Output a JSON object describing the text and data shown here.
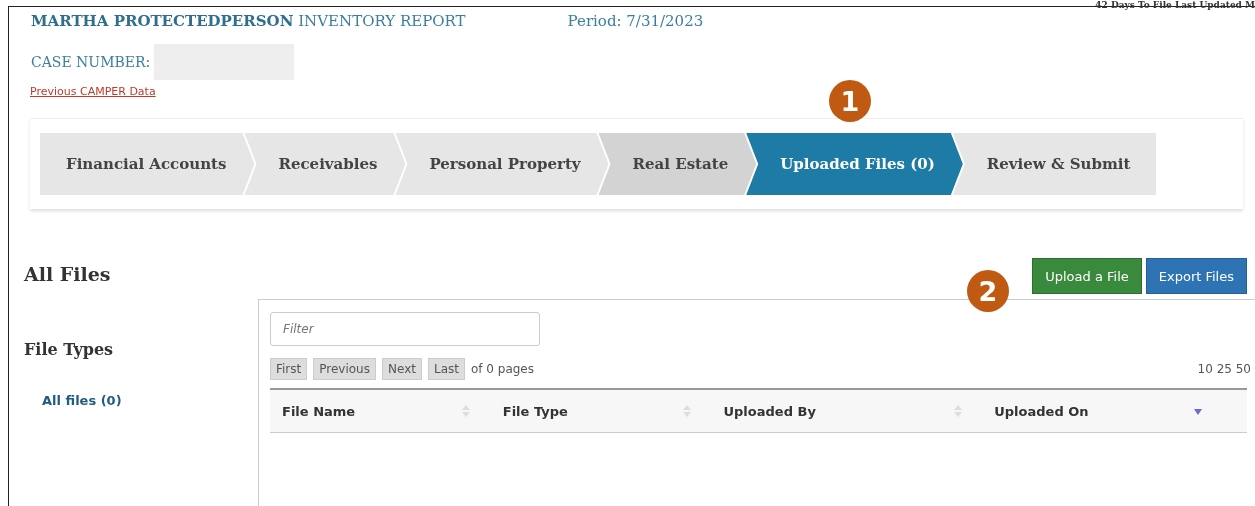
{
  "header": {
    "name": "MARTHA PROTECTEDPERSON",
    "report": "INVENTORY REPORT",
    "period": "Period: 7/31/2023",
    "corner_text": "42 Days To File Last Updated M",
    "case_label": "CASE NUMBER:",
    "previous_link": "Previous CAMPER Data"
  },
  "steps": [
    {
      "label": "Financial Accounts",
      "selected": false,
      "shaded": false
    },
    {
      "label": "Receivables",
      "selected": false,
      "shaded": false
    },
    {
      "label": "Personal Property",
      "selected": false,
      "shaded": false
    },
    {
      "label": "Real Estate",
      "selected": false,
      "shaded": true
    },
    {
      "label": "Uploaded Files (0)",
      "selected": true,
      "shaded": false
    },
    {
      "label": "Review & Submit",
      "selected": false,
      "shaded": false
    }
  ],
  "callouts": [
    "1",
    "2"
  ],
  "section_title": "All Files",
  "buttons": [
    {
      "label": "Upload a File",
      "kind": "primary"
    },
    {
      "label": "Export Files",
      "kind": "secondary"
    }
  ],
  "sidebar": {
    "title": "File Types",
    "items": [
      {
        "label": "All files (0)"
      }
    ]
  },
  "table": {
    "filter_placeholder": "Filter",
    "pager": [
      "First",
      "Previous",
      "Next",
      "Last"
    ],
    "pages_text": "of 0 pages",
    "page_sizes": "10 25 50",
    "columns": [
      {
        "label": "File Name",
        "sorted": false
      },
      {
        "label": "File Type",
        "sorted": false
      },
      {
        "label": "Uploaded By",
        "sorted": false
      },
      {
        "label": "Uploaded On",
        "sorted": true
      }
    ]
  }
}
